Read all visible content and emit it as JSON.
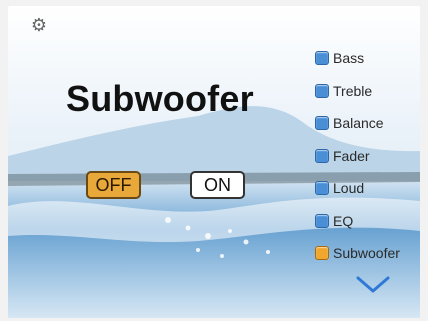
{
  "screen": {
    "title": "Subwoofer",
    "settings_icon": "gear-icon",
    "toggle": {
      "off_label": "OFF",
      "on_label": "ON",
      "selected": "OFF"
    },
    "menu": {
      "items": [
        {
          "label": "Bass",
          "selected": false
        },
        {
          "label": "Treble",
          "selected": false
        },
        {
          "label": "Balance",
          "selected": false
        },
        {
          "label": "Fader",
          "selected": false
        },
        {
          "label": "Loud",
          "selected": false
        },
        {
          "label": "EQ",
          "selected": false
        },
        {
          "label": "Subwoofer",
          "selected": true
        }
      ]
    },
    "scroll_icon": "chevron-down-icon",
    "colors": {
      "selected": "#f0a72e",
      "unselected": "#4a8fd6",
      "chevron": "#2f79d6"
    }
  }
}
